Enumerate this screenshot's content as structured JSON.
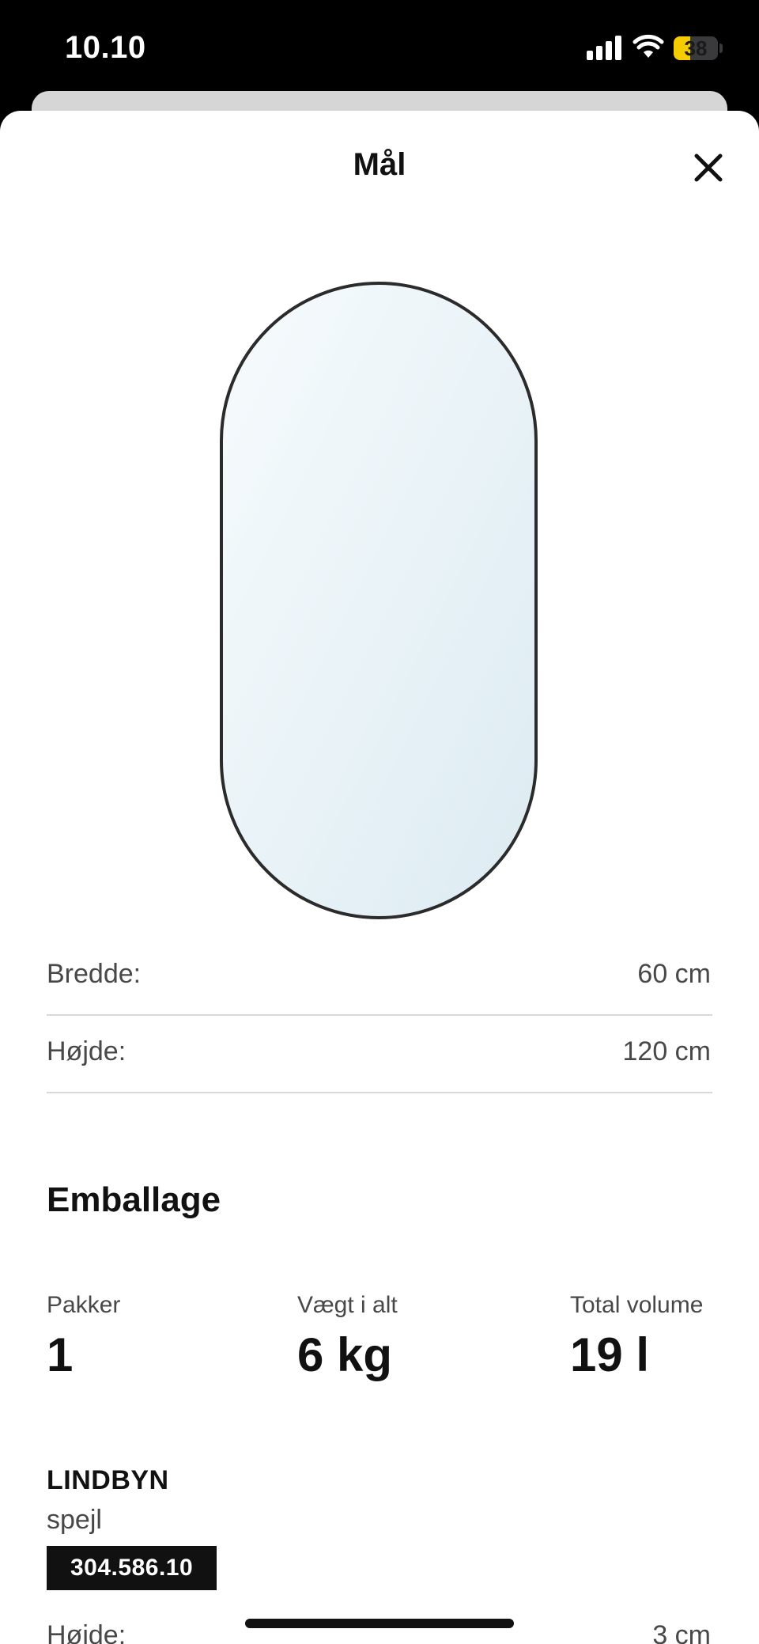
{
  "status_bar": {
    "time": "10.10",
    "battery_level": "38",
    "battery_fraction": 0.38,
    "signal_bars": 4
  },
  "sheet": {
    "title": "Mål",
    "close_icon": "close-icon"
  },
  "product_image": {
    "icon": "oval-mirror-illustration",
    "frame_color": "#2b2b2b",
    "glass_color_top": "#f7fbfd",
    "glass_color_bottom": "#dcebf2"
  },
  "dimensions": [
    {
      "label": "Bredde:",
      "value": "60 cm"
    },
    {
      "label": "Højde:",
      "value": "120 cm"
    }
  ],
  "packaging": {
    "heading": "Emballage",
    "stats": [
      {
        "label": "Pakker",
        "value": "1"
      },
      {
        "label": "Vægt i alt",
        "value": "6 kg"
      },
      {
        "label": "Total volume",
        "value": "19 l"
      }
    ],
    "product": {
      "name": "LINDBYN",
      "type": "spejl",
      "article_number": "304.586.10"
    },
    "partial_row": {
      "label": "Højde:",
      "value": "3 cm"
    }
  }
}
